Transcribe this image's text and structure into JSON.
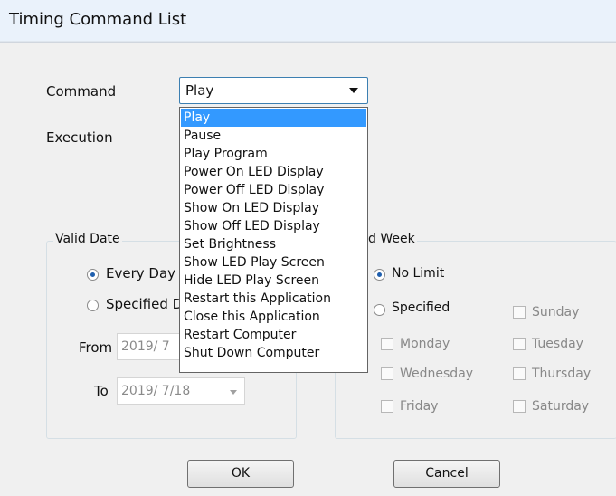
{
  "window": {
    "title": "Timing Command List"
  },
  "command": {
    "label": "Command",
    "selected": "Play",
    "options": [
      "Play",
      "Pause",
      "Play Program",
      "Power On LED Display",
      "Power Off LED Display",
      "Show On LED Display",
      "Show Off LED Display",
      "Set Brightness",
      "Show LED Play Screen",
      "Hide  LED Play Screen",
      "Restart this Application",
      "Close this Application",
      "Restart Computer",
      "Shut Down Computer"
    ]
  },
  "execution": {
    "label": "Execution"
  },
  "valid_date": {
    "group_label": "Valid Date",
    "every_day_label": "Every Day",
    "specified_label": "Specified D",
    "from_label": "From",
    "from_value": "2019/  7",
    "to_label": "To",
    "to_value": "2019/  7/18"
  },
  "valid_week": {
    "group_label": "d Week",
    "no_limit_label": "No Limit",
    "specified_label": "Specified",
    "days": [
      "Sunday",
      "Monday",
      "Tuesday",
      "Wednesday",
      "Thursday",
      "Friday",
      "Saturday"
    ]
  },
  "buttons": {
    "ok": "OK",
    "cancel": "Cancel"
  },
  "colors": {
    "selection": "#3399ff",
    "title_bar": "#eaf2fb",
    "combo_border": "#3c7fb1"
  }
}
